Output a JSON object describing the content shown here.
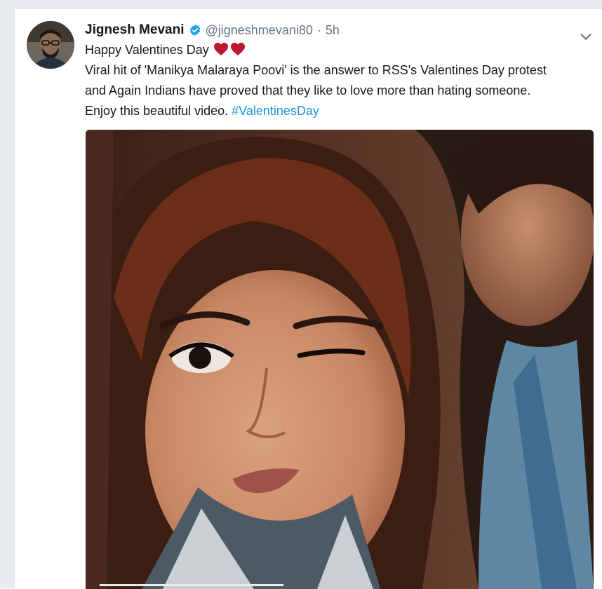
{
  "tweet": {
    "display_name": "Jignesh Mevani",
    "handle": "@jigneshmevani80",
    "separator": "·",
    "time": "5h",
    "line1": "Happy Valentines Day",
    "line2": "Viral hit of 'Manikya Malaraya Poovi' is the answer to RSS's Valentines Day protest",
    "line3": "and Again Indians have proved that they like to love more than hating someone.",
    "line4_prefix": "Enjoy this beautiful video. ",
    "hashtag": "#ValentinesDay"
  },
  "icons": {
    "verified": "verified-badge-icon",
    "chevron": "chevron-down-icon",
    "hearts": [
      "red-heart-emoji",
      "red-heart-emoji"
    ]
  },
  "colors": {
    "link": "#1b95e0",
    "verified": "#1da1f2",
    "heart": "#be1931",
    "secondary_text": "#657786"
  }
}
